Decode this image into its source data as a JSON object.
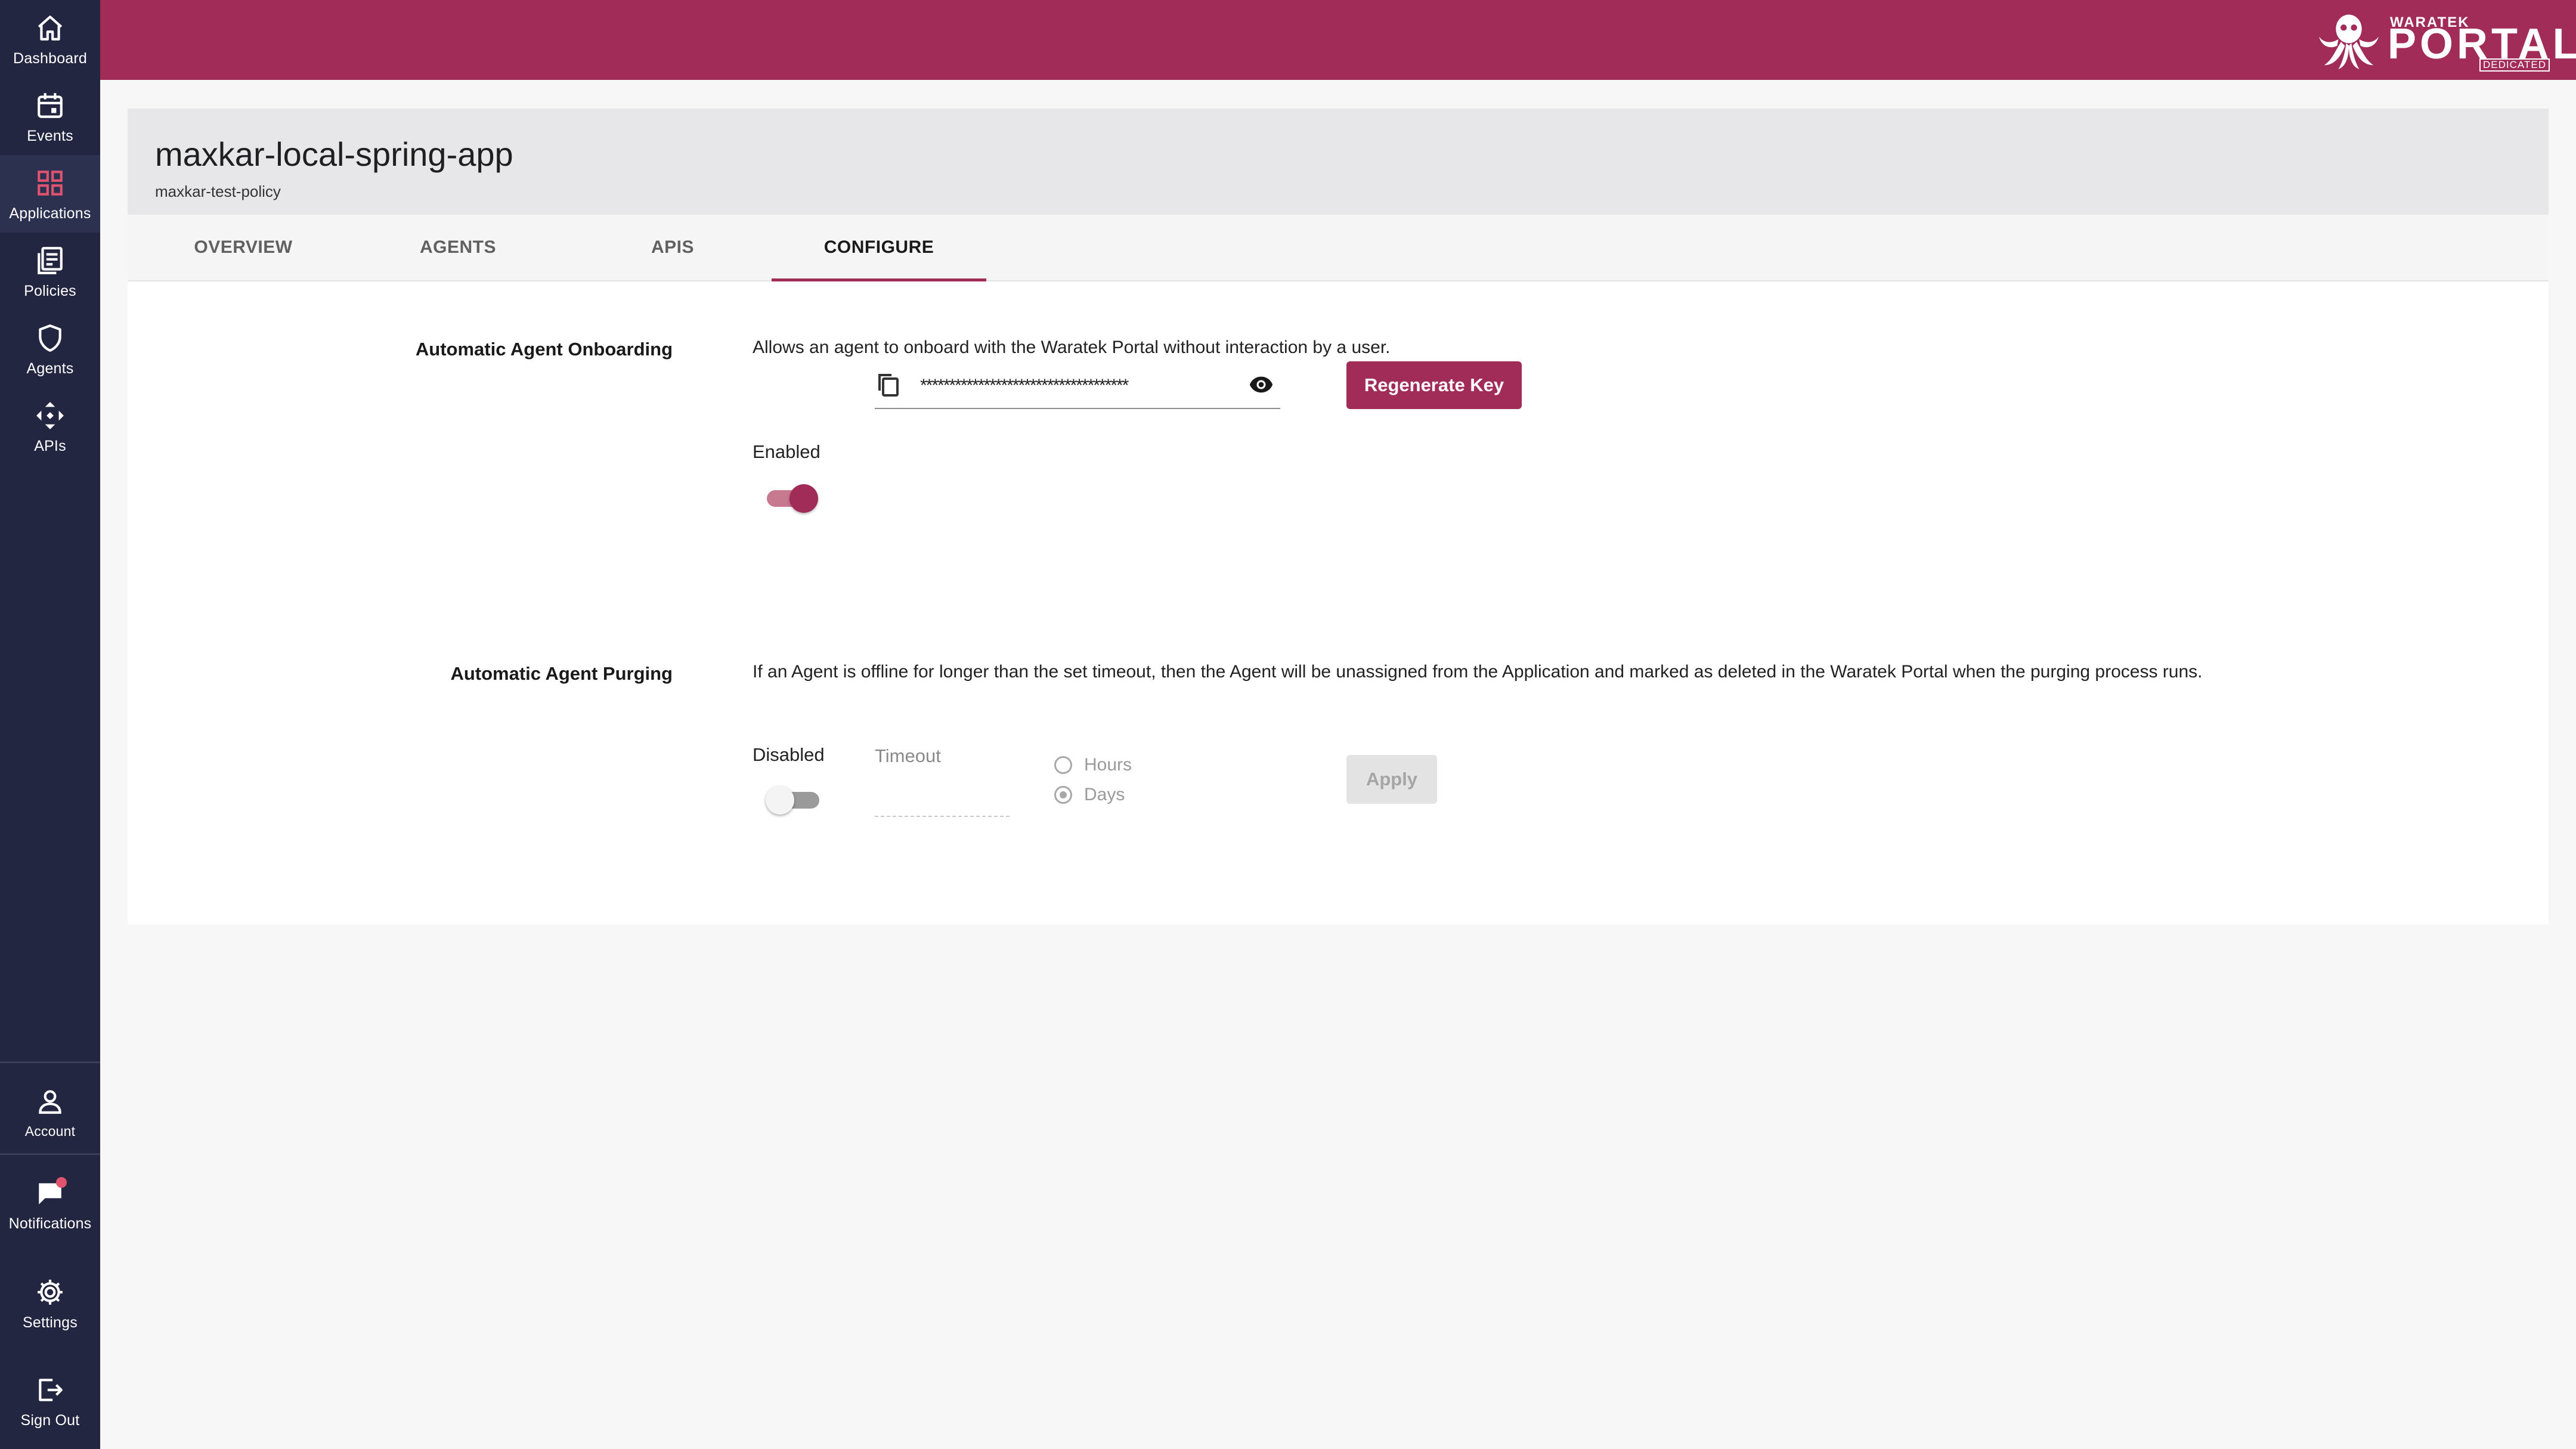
{
  "sidebar": {
    "items": [
      {
        "label": "Dashboard",
        "icon": "home-icon"
      },
      {
        "label": "Events",
        "icon": "calendar-icon"
      },
      {
        "label": "Applications",
        "icon": "grid-icon",
        "active": true
      },
      {
        "label": "Policies",
        "icon": "document-list-icon"
      },
      {
        "label": "Agents",
        "icon": "shield-icon"
      },
      {
        "label": "APIs",
        "icon": "api-arrows-icon"
      }
    ],
    "bottom": [
      {
        "label": "Account",
        "icon": "person-icon"
      },
      {
        "label": "Notifications",
        "icon": "chat-bubble-icon",
        "badge": true
      },
      {
        "label": "Settings",
        "icon": "gear-icon"
      },
      {
        "label": "Sign Out",
        "icon": "sign-out-icon"
      }
    ]
  },
  "brand": {
    "small": "WARATEK",
    "name": "PORTAL",
    "tag": "DEDICATED",
    "color": "#a22c58"
  },
  "app": {
    "title": "maxkar-local-spring-app",
    "policy": "maxkar-test-policy"
  },
  "tabs": [
    {
      "label": "OVERVIEW"
    },
    {
      "label": "AGENTS"
    },
    {
      "label": "APIS"
    },
    {
      "label": "CONFIGURE",
      "active": true
    }
  ],
  "onboarding": {
    "label": "Automatic Agent Onboarding",
    "description": "Allows an agent to onboard with the Waratek Portal without interaction by a user.",
    "status": "Enabled",
    "enabled": true,
    "key_mask": "************************************",
    "regenerate_label": "Regenerate Key"
  },
  "purging": {
    "label": "Automatic Agent Purging",
    "description": "If an Agent is offline for longer than the set timeout, then the Agent will be unassigned from the Application and marked as deleted in the Waratek Portal when the purging process runs.",
    "status": "Disabled",
    "enabled": false,
    "timeout_label": "Timeout",
    "timeout_value": "",
    "units": [
      {
        "label": "Hours",
        "selected": false
      },
      {
        "label": "Days",
        "selected": true
      }
    ],
    "apply_label": "Apply"
  }
}
